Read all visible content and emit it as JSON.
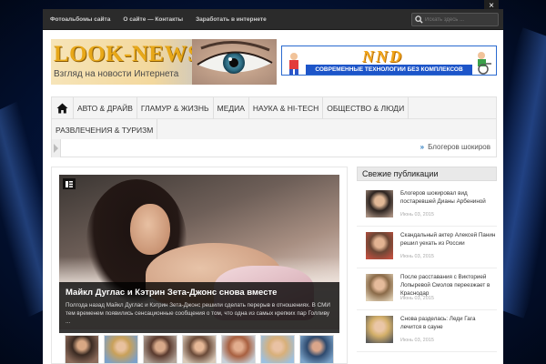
{
  "topbar": {
    "links": [
      "Фотоальбомы сайта",
      "О сайте — Контакты",
      "Заработать в интернете"
    ],
    "search_placeholder": "Искать здесь ...",
    "close_label": "×"
  },
  "header": {
    "logo_title": "LOOK-NEWS",
    "logo_subtitle": "Взгляд на новости Интернета",
    "banner_brand": "NND",
    "banner_tagline": "СОВРЕМЕННЫЕ ТЕХНОЛОГИИ БЕЗ КОМПЛЕКСОВ"
  },
  "nav": {
    "row1": [
      "АВТО & ДРАЙВ",
      "ГЛАМУР & ЖИЗНЬ",
      "МЕДИА",
      "НАУКА & HI-TECH",
      "ОБЩЕСТВО & ЛЮДИ"
    ],
    "row2": [
      "РАЗВЛЕЧЕНИЯ & ТУРИЗМ"
    ]
  },
  "ticker": {
    "arrow": "»",
    "text": "Блогеров шокиров"
  },
  "featured": {
    "title": "Майкл Дуглас и Кэтрин Зета-Джонс снова вместе",
    "excerpt": "Полгода назад Майкл Дуглас и Кэтрин Зета-Джонс решили сделать перерыв в отношениях. В СМИ тем временем появились сенсационные сообщения о том, что одна из самых крепких пар Голливу ..."
  },
  "sidebar": {
    "heading": "Свежие публикации",
    "items": [
      {
        "title": "Блогеров шокировал вид постаревшей Дианы Арбениной",
        "date": "Июнь 03, 2015"
      },
      {
        "title": "Скандальный актер Алексей Панин решил уехать из России",
        "date": "Июнь 03, 2015"
      },
      {
        "title": "После расставания с Викторией Лопыревой Смолов переезжает в Краснодар",
        "date": "Июнь 03, 2015"
      },
      {
        "title": "Снова разделась: Леди Гага лечится в сауне",
        "date": "Июнь 03, 2015"
      }
    ]
  },
  "colors": {
    "accent": "#2a7abf",
    "topbar": "#2b2b2b",
    "logo_gold": "#e8a818",
    "banner_blue": "#1d55c9"
  }
}
